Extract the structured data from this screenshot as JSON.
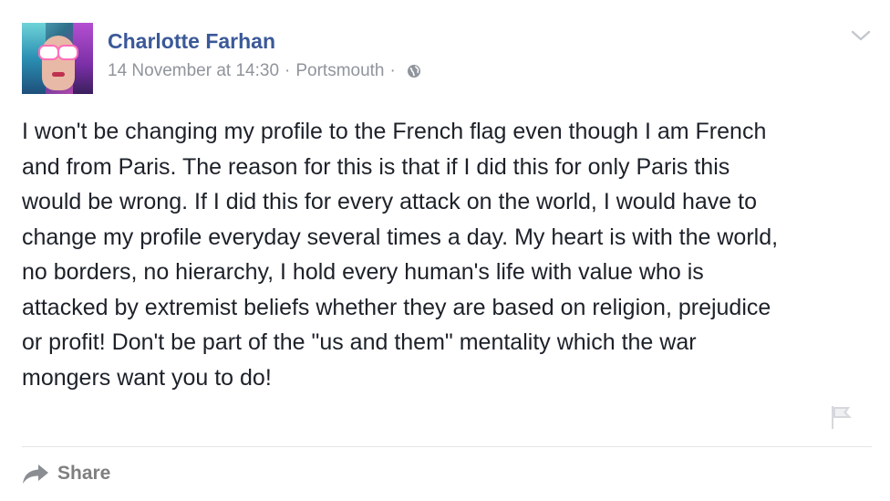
{
  "post": {
    "author": "Charlotte Farhan",
    "timestamp": "14 November at 14:30",
    "separator": "·",
    "location": "Portsmouth",
    "privacy_icon": "globe-icon",
    "menu_icon": "chevron-down-icon",
    "body": "I won't be changing my profile to the French flag even though I am French\nand from Paris. The reason for this is that if I did this for only Paris this\nwould be wrong. If I did this for every attack on the world, I would have to\nchange my profile everyday several times a day. My heart is with the world,\nno borders, no hierarchy, I hold every human's life with value who is\nattacked by extremist beliefs whether they are based on religion, prejudice\nor profit! Don't be part of the \"us and them\" mentality which the war\nmongers want you to do!",
    "report_icon": "flag-icon"
  },
  "actions": {
    "share_label": "Share",
    "share_icon": "share-arrow-icon"
  },
  "colors": {
    "author_name": "#3b5998",
    "meta_text": "#90949c",
    "body_text": "#1d2129",
    "action_text": "#7f7f7f"
  }
}
